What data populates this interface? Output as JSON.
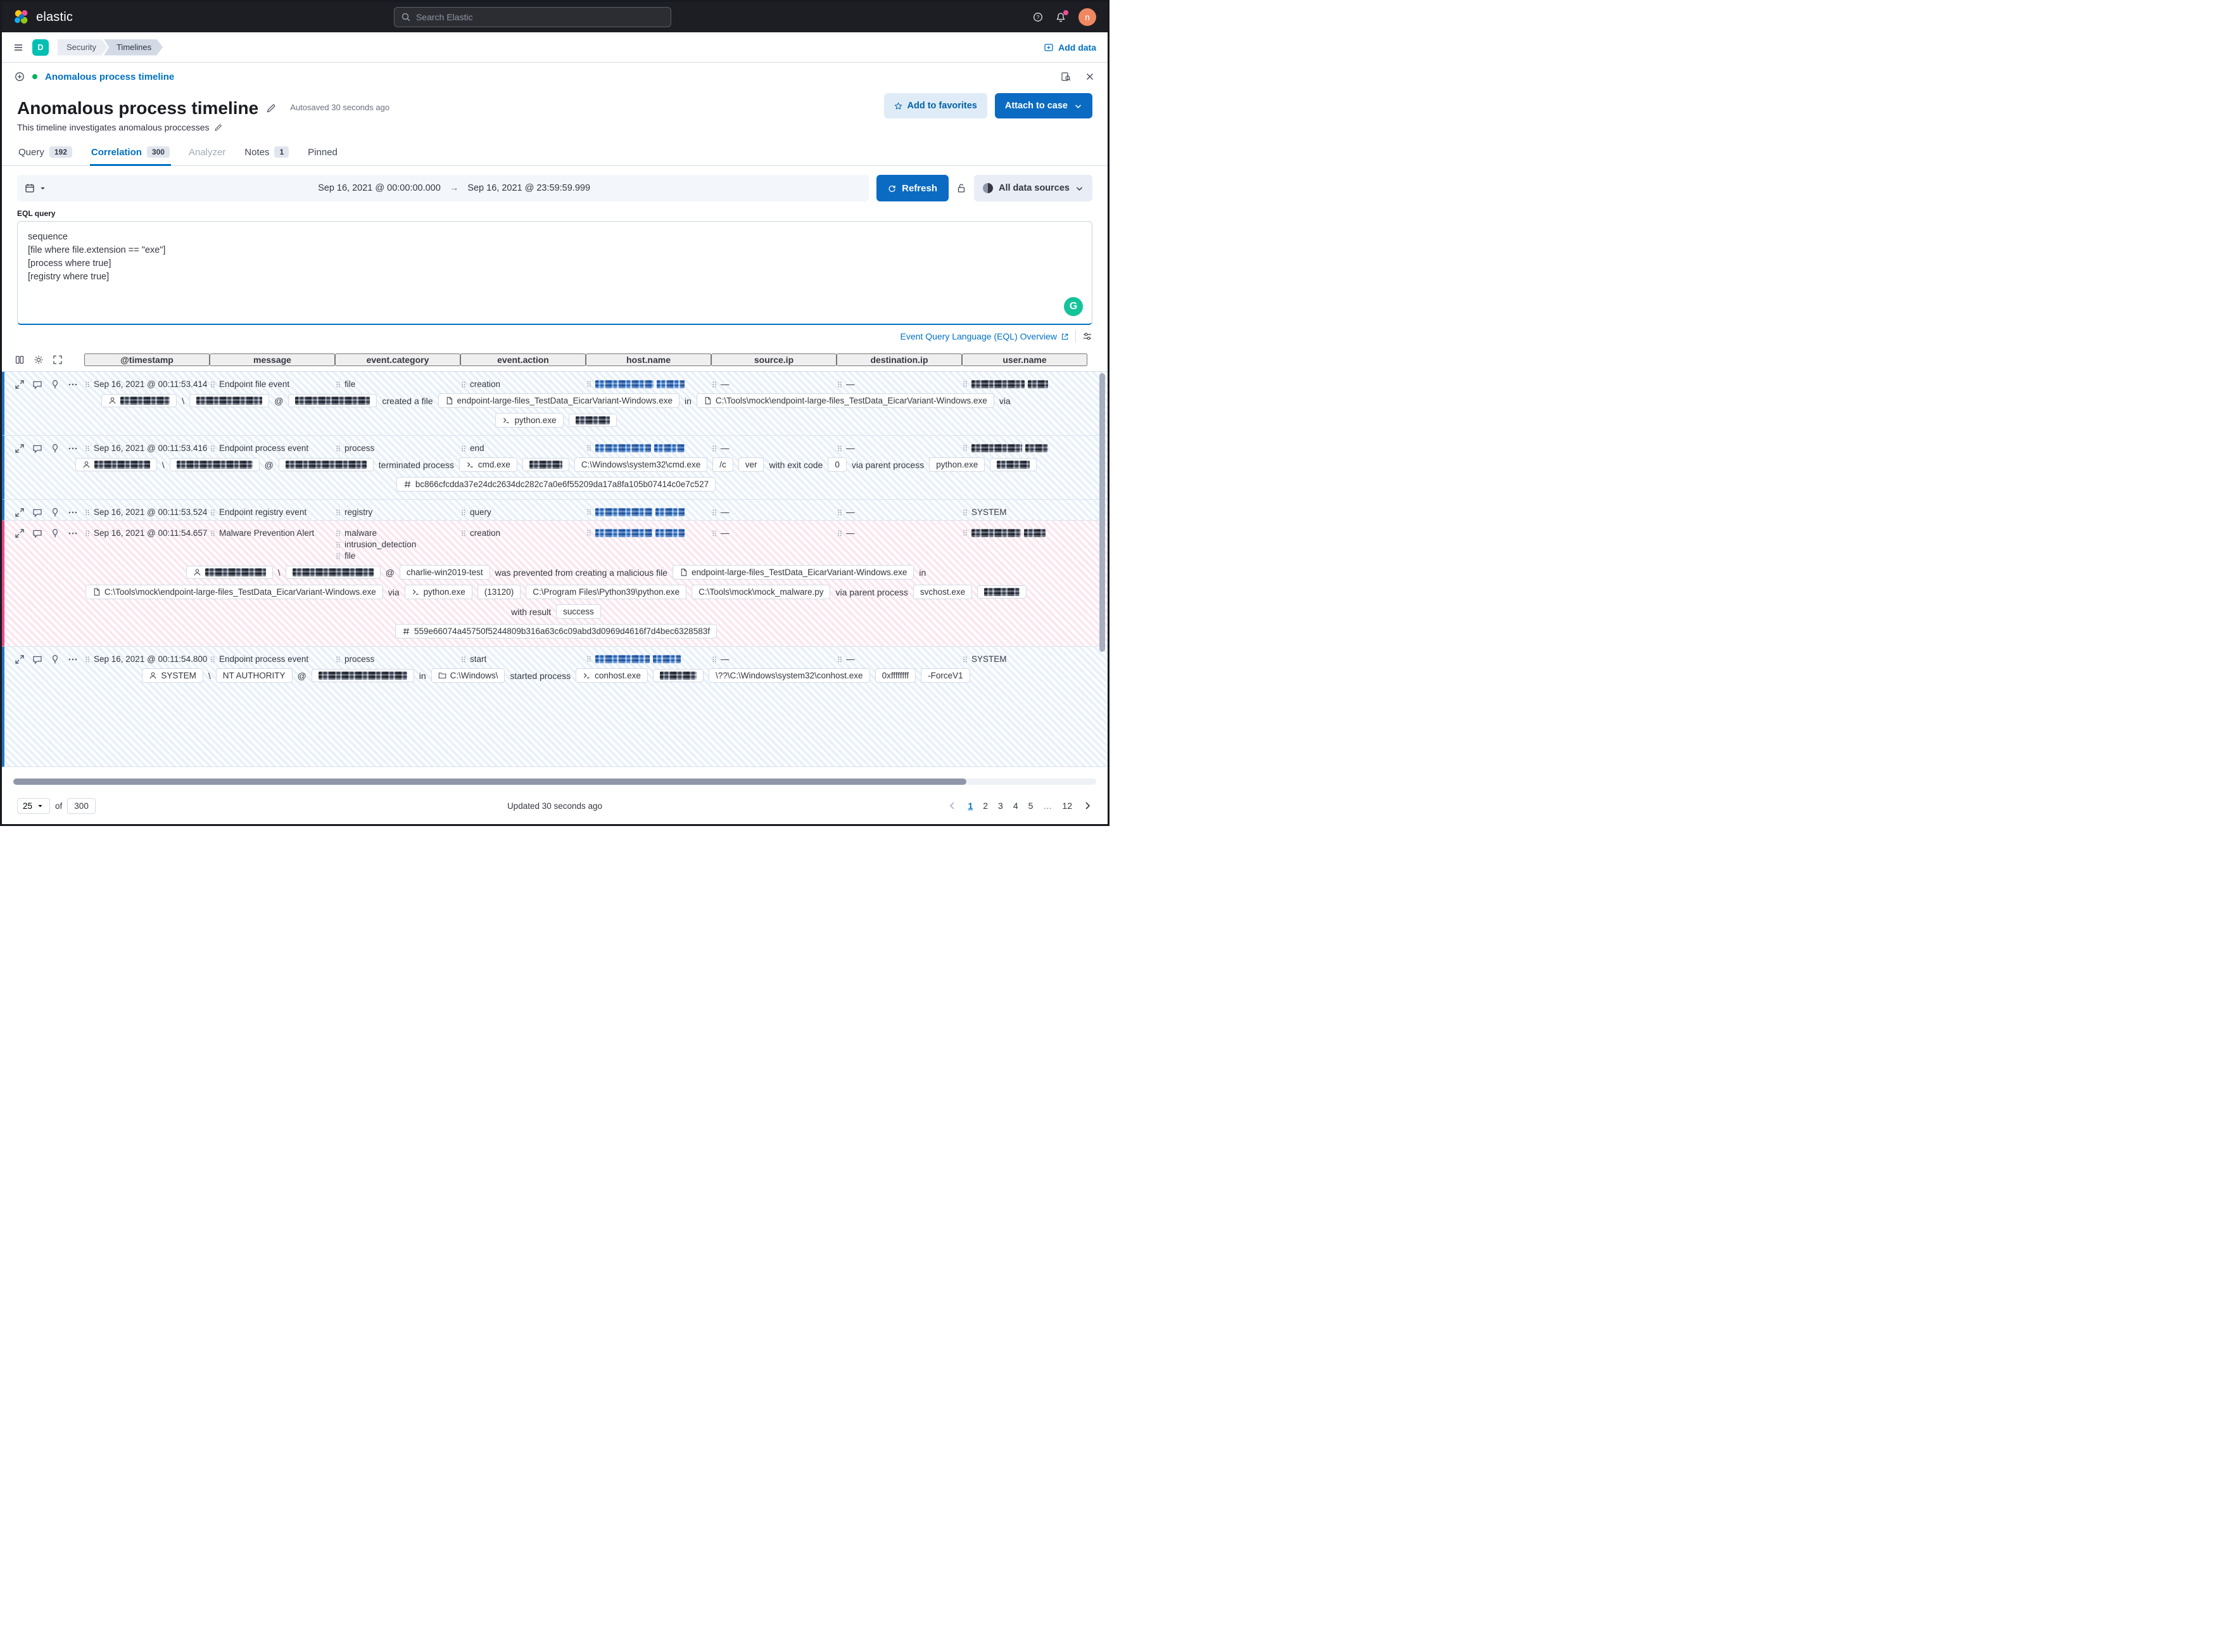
{
  "topbar": {
    "brand": "elastic",
    "search_placeholder": "Search Elastic",
    "user_initial": "n"
  },
  "navbar": {
    "space_initial": "D",
    "breadcrumbs": [
      "Security",
      "Timelines"
    ],
    "add_data": "Add data"
  },
  "strip": {
    "title": "Anomalous process timeline"
  },
  "header": {
    "title": "Anomalous process timeline",
    "autosave": "Autosaved 30 seconds ago",
    "description": "This timeline investigates anomalous proccesses",
    "favorites_label": "Add to favorites",
    "attach_label": "Attach to case"
  },
  "tabs": [
    {
      "label": "Query",
      "badge": "192"
    },
    {
      "label": "Correlation",
      "badge": "300"
    },
    {
      "label": "Analyzer"
    },
    {
      "label": "Notes",
      "badge": "1"
    },
    {
      "label": "Pinned"
    }
  ],
  "daterow": {
    "start": "Sep 16, 2021 @ 00:00:00.000",
    "end": "Sep 16, 2021 @ 23:59:59.999",
    "refresh_label": "Refresh",
    "sources_label": "All data sources"
  },
  "eql": {
    "label": "EQL query",
    "query": "sequence\n[file where file.extension == \"exe\"]\n[process where true]\n[registry where true]",
    "overview_link": "Event Query Language (EQL) Overview"
  },
  "table": {
    "columns": [
      "@timestamp",
      "message",
      "event.category",
      "event.action",
      "host.name",
      "source.ip",
      "destination.ip",
      "user.name"
    ],
    "rows": [
      {
        "alert": false,
        "cells": {
          "timestamp": {
            "l": "Sep 16, 2021 @ 00:11:53.414"
          },
          "message": {
            "l": "Endpoint file event"
          },
          "category": {
            "lines": [
              "file"
            ]
          },
          "action": {
            "l": "creation"
          },
          "host": {
            "r": [
              92,
              44
            ],
            "tone": "blue"
          },
          "source": {
            "l": "—"
          },
          "dest": {
            "l": "—"
          },
          "user": {
            "r": [
              84,
              32
            ]
          }
        },
        "details": [
          [
            {
              "b": 1,
              "i": "user-icon",
              "r": 78
            },
            {
              "t": "\\"
            },
            {
              "b": 1,
              "r": 104
            },
            {
              "t": "@"
            },
            {
              "b": 1,
              "r": 118
            },
            {
              "t": "created a file"
            },
            {
              "b": 1,
              "i": "document-icon",
              "l": "endpoint-large-files_TestData_EicarVariant-Windows.exe"
            },
            {
              "t": "in"
            },
            {
              "b": 1,
              "i": "document-icon",
              "l": "C:\\Tools\\mock\\endpoint-large-files_TestData_EicarVariant-Windows.exe"
            },
            {
              "t": "via"
            }
          ],
          [
            {
              "b": 1,
              "i": "terminal-icon",
              "l": "python.exe"
            },
            {
              "b": 1,
              "r": 54
            }
          ]
        ]
      },
      {
        "alert": false,
        "cells": {
          "timestamp": {
            "l": "Sep 16, 2021 @ 00:11:53.416"
          },
          "message": {
            "l": "Endpoint process event"
          },
          "category": {
            "lines": [
              "process"
            ]
          },
          "action": {
            "l": "end"
          },
          "host": {
            "r": [
              88,
              48
            ],
            "tone": "blue"
          },
          "source": {
            "l": "—"
          },
          "dest": {
            "l": "—"
          },
          "user": {
            "r": [
              80,
              36
            ]
          }
        },
        "details": [
          [
            {
              "b": 1,
              "i": "user-icon",
              "r": 88
            },
            {
              "t": "\\"
            },
            {
              "b": 1,
              "r": 120
            },
            {
              "t": "@"
            },
            {
              "b": 1,
              "r": 128
            },
            {
              "t": "terminated process"
            },
            {
              "b": 1,
              "i": "terminal-icon",
              "l": "cmd.exe"
            },
            {
              "b": 1,
              "r": 52
            },
            {
              "b": 1,
              "l": "C:\\Windows\\system32\\cmd.exe"
            },
            {
              "b": 1,
              "l": "/c"
            },
            {
              "b": 1,
              "l": "ver"
            },
            {
              "t": "with exit code"
            },
            {
              "b": 1,
              "l": "0"
            },
            {
              "t": "via parent process"
            },
            {
              "b": 1,
              "l": "python.exe"
            },
            {
              "b": 1,
              "r": 52
            }
          ],
          [
            {
              "b": 1,
              "i": "hash-icon",
              "l": "bc866cfcdda37e24dc2634dc282c7a0e6f55209da17a8fa105b07414c0e7c527"
            }
          ]
        ]
      },
      {
        "alert": false,
        "cells": {
          "timestamp": {
            "l": "Sep 16, 2021 @ 00:11:53.524"
          },
          "message": {
            "l": "Endpoint registry event"
          },
          "category": {
            "lines": [
              "registry"
            ]
          },
          "action": {
            "l": "query"
          },
          "host": {
            "r": [
              90,
              46
            ],
            "tone": "blue"
          },
          "source": {
            "l": "—"
          },
          "dest": {
            "l": "—"
          },
          "user": {
            "l": "SYSTEM"
          }
        },
        "details": []
      },
      {
        "alert": true,
        "cells": {
          "timestamp": {
            "l": "Sep 16, 2021 @ 00:11:54.657"
          },
          "message": {
            "l": "Malware Prevention Alert"
          },
          "category": {
            "lines": [
              "malware",
              "intrusion_detection",
              "file"
            ]
          },
          "action": {
            "l": "creation"
          },
          "host": {
            "r": [
              90,
              46
            ],
            "tone": "blue"
          },
          "source": {
            "l": "—"
          },
          "dest": {
            "l": "—"
          },
          "user": {
            "r": [
              78,
              34
            ]
          }
        },
        "details": [
          [
            {
              "b": 1,
              "i": "user-icon",
              "r": 96
            },
            {
              "t": "\\"
            },
            {
              "b": 1,
              "r": 128
            },
            {
              "t": "@"
            },
            {
              "b": 1,
              "l": "charlie-win2019-test"
            },
            {
              "t": "was prevented from creating a malicious file"
            },
            {
              "b": 1,
              "i": "document-icon",
              "l": "endpoint-large-files_TestData_EicarVariant-Windows.exe"
            },
            {
              "t": "in"
            }
          ],
          [
            {
              "b": 1,
              "i": "document-icon",
              "l": "C:\\Tools\\mock\\endpoint-large-files_TestData_EicarVariant-Windows.exe"
            },
            {
              "t": "via"
            },
            {
              "b": 1,
              "i": "terminal-icon",
              "l": "python.exe"
            },
            {
              "b": 1,
              "l": "(13120)"
            },
            {
              "b": 1,
              "l": "C:\\Program Files\\Python39\\python.exe"
            },
            {
              "b": 1,
              "l": "C:\\Tools\\mock\\mock_malware.py"
            },
            {
              "t": "via parent process"
            },
            {
              "b": 1,
              "l": "svchost.exe"
            },
            {
              "b": 1,
              "r": 56
            }
          ],
          [
            {
              "t": "with result"
            },
            {
              "b": 1,
              "l": "success"
            }
          ],
          [
            {
              "b": 1,
              "i": "hash-icon",
              "l": "559e66074a45750f5244809b316a63c6c09abd3d0969d4616f7d4bec6328583f"
            }
          ]
        ]
      },
      {
        "alert": false,
        "cells": {
          "timestamp": {
            "l": "Sep 16, 2021 @ 00:11:54.800"
          },
          "message": {
            "l": "Endpoint process event"
          },
          "category": {
            "lines": [
              "process"
            ]
          },
          "action": {
            "l": "start"
          },
          "host": {
            "r": [
              86,
              44
            ],
            "tone": "blue"
          },
          "source": {
            "l": "—"
          },
          "dest": {
            "l": "—"
          },
          "user": {
            "l": "SYSTEM"
          }
        },
        "details": [
          [
            {
              "b": 1,
              "i": "user-icon",
              "l": "SYSTEM"
            },
            {
              "t": "\\"
            },
            {
              "b": 1,
              "l": "NT AUTHORITY"
            },
            {
              "t": "@"
            },
            {
              "b": 1,
              "r": 140
            },
            {
              "t": "in"
            },
            {
              "b": 1,
              "i": "folder-icon",
              "l": "C:\\Windows\\"
            },
            {
              "t": "started process"
            },
            {
              "b": 1,
              "i": "terminal-icon",
              "l": "conhost.exe"
            },
            {
              "b": 1,
              "r": 58
            },
            {
              "b": 1,
              "l": "\\??\\C:\\Windows\\system32\\conhost.exe"
            },
            {
              "b": 1,
              "l": "0xffffffff"
            },
            {
              "b": 1,
              "l": "-ForceV1"
            }
          ]
        ]
      }
    ]
  },
  "footer": {
    "per_page": "25",
    "of_label": "of",
    "total": "300",
    "updated": "Updated 30 seconds ago",
    "pages": [
      {
        "label": "1",
        "active": true
      },
      {
        "label": "2"
      },
      {
        "label": "3"
      },
      {
        "label": "4"
      },
      {
        "label": "5"
      },
      {
        "label": "…",
        "ellipsis": true
      },
      {
        "label": "12"
      }
    ]
  }
}
